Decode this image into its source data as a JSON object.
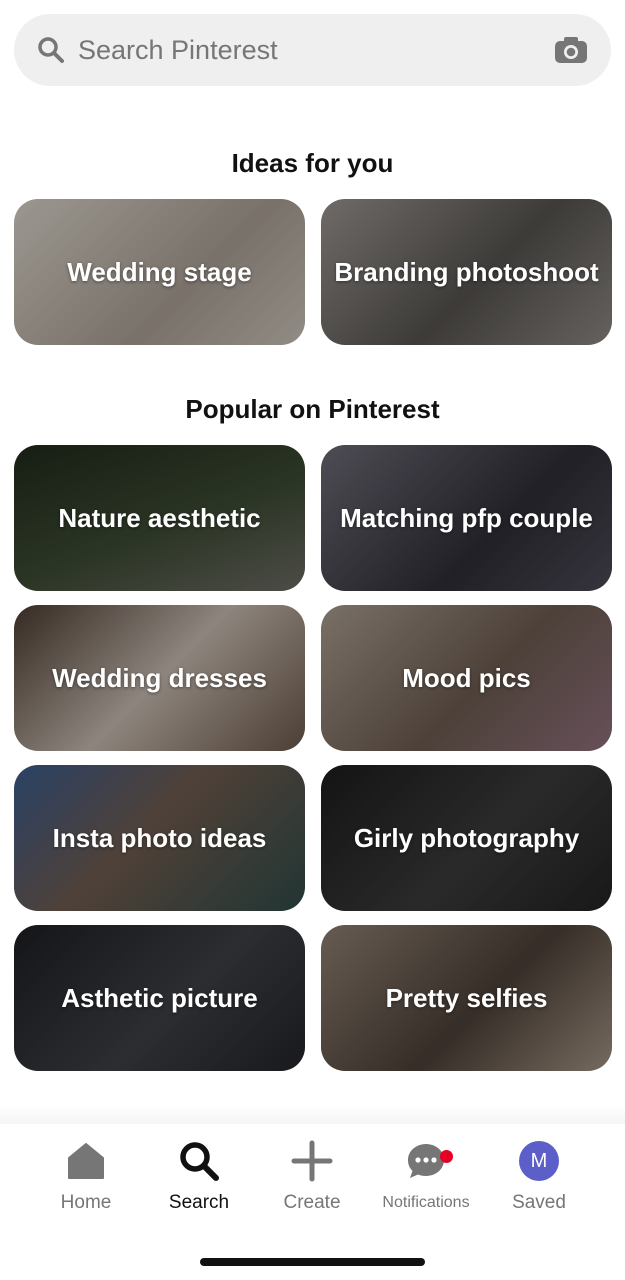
{
  "search": {
    "placeholder": "Search Pinterest"
  },
  "ideas": {
    "title": "Ideas for you",
    "tiles": [
      {
        "label": "Wedding stage",
        "color": "#b9b1a8"
      },
      {
        "label": "Branding photoshoot",
        "color": "#7a7672"
      }
    ]
  },
  "popular": {
    "title": "Popular on Pinterest",
    "tiles": [
      {
        "label": "Nature aesthetic",
        "color": "#2f3a2a"
      },
      {
        "label": "Matching pfp couple",
        "color": "#4a4a55"
      },
      {
        "label": "Wedding dresses",
        "color": "#8b7d72"
      },
      {
        "label": "Mood pics",
        "color": "#7d6f63"
      },
      {
        "label": "Insta photo ideas",
        "color": "#5b4e48"
      },
      {
        "label": "Girly photography",
        "color": "#2a2a2a"
      },
      {
        "label": "Asthetic picture",
        "color": "#2b2c30"
      },
      {
        "label": "Pretty selfies",
        "color": "#6e6158"
      }
    ]
  },
  "nav": {
    "items": [
      {
        "label": "Home",
        "icon": "home-icon"
      },
      {
        "label": "Search",
        "icon": "search-icon",
        "active": true
      },
      {
        "label": "Create",
        "icon": "plus-icon"
      },
      {
        "label": "Notifications",
        "icon": "chat-bubble-icon",
        "badge": true
      },
      {
        "label": "Saved",
        "icon": "avatar",
        "avatar_letter": "M"
      }
    ]
  },
  "colors": {
    "accent": "#e60023",
    "avatar_bg": "#5b5fc7"
  }
}
